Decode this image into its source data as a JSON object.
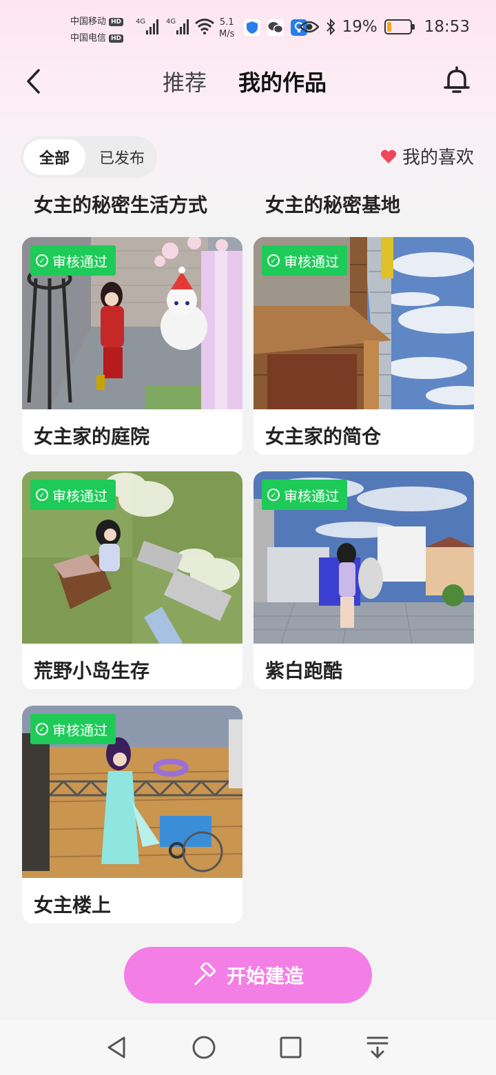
{
  "status_bar": {
    "carrier1": "中国移动",
    "carrier2": "中国电信",
    "hd_label": "HD",
    "network_label": "4G",
    "speed_value": "5.1",
    "speed_unit": "M/s",
    "battery_percent": "19%",
    "battery_level": 0.19,
    "time": "18:53"
  },
  "nav": {
    "tab_recommended": "推荐",
    "tab_my_works": "我的作品"
  },
  "filter": {
    "all_label": "全部",
    "published_label": "已发布",
    "favorites_label": "我的喜欢"
  },
  "partial_titles": [
    "女主的秘密生活方式",
    "女主的秘密基地"
  ],
  "badge_label": "审核通过",
  "works": [
    {
      "title": "女主家的庭院"
    },
    {
      "title": "女主家的简仓"
    },
    {
      "title": "荒野小岛生存"
    },
    {
      "title": "紫白跑酷"
    },
    {
      "title": "女主楼上"
    }
  ],
  "build_button": {
    "label": "开始建造"
  },
  "colors": {
    "accent_pink": "#f37fe6",
    "badge_green": "#1ecb58",
    "heart_red": "#f0455a"
  }
}
